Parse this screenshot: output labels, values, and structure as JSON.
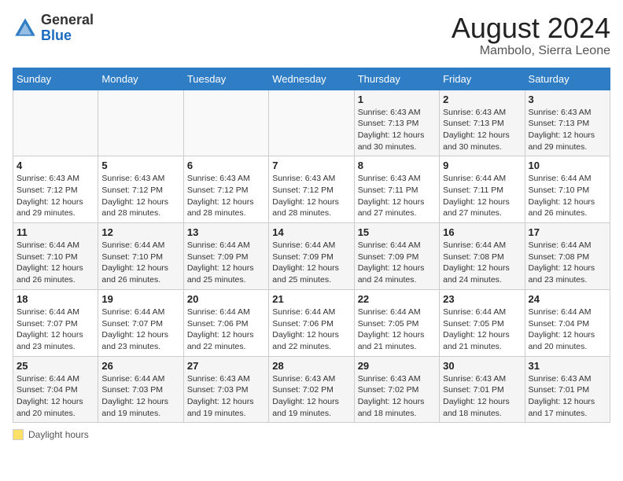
{
  "header": {
    "logo_general": "General",
    "logo_blue": "Blue",
    "month_year": "August 2024",
    "location": "Mambolo, Sierra Leone"
  },
  "days_of_week": [
    "Sunday",
    "Monday",
    "Tuesday",
    "Wednesday",
    "Thursday",
    "Friday",
    "Saturday"
  ],
  "weeks": [
    [
      {
        "day": "",
        "info": ""
      },
      {
        "day": "",
        "info": ""
      },
      {
        "day": "",
        "info": ""
      },
      {
        "day": "",
        "info": ""
      },
      {
        "day": "1",
        "info": "Sunrise: 6:43 AM\nSunset: 7:13 PM\nDaylight: 12 hours\nand 30 minutes."
      },
      {
        "day": "2",
        "info": "Sunrise: 6:43 AM\nSunset: 7:13 PM\nDaylight: 12 hours\nand 30 minutes."
      },
      {
        "day": "3",
        "info": "Sunrise: 6:43 AM\nSunset: 7:13 PM\nDaylight: 12 hours\nand 29 minutes."
      }
    ],
    [
      {
        "day": "4",
        "info": "Sunrise: 6:43 AM\nSunset: 7:12 PM\nDaylight: 12 hours\nand 29 minutes."
      },
      {
        "day": "5",
        "info": "Sunrise: 6:43 AM\nSunset: 7:12 PM\nDaylight: 12 hours\nand 28 minutes."
      },
      {
        "day": "6",
        "info": "Sunrise: 6:43 AM\nSunset: 7:12 PM\nDaylight: 12 hours\nand 28 minutes."
      },
      {
        "day": "7",
        "info": "Sunrise: 6:43 AM\nSunset: 7:12 PM\nDaylight: 12 hours\nand 28 minutes."
      },
      {
        "day": "8",
        "info": "Sunrise: 6:43 AM\nSunset: 7:11 PM\nDaylight: 12 hours\nand 27 minutes."
      },
      {
        "day": "9",
        "info": "Sunrise: 6:44 AM\nSunset: 7:11 PM\nDaylight: 12 hours\nand 27 minutes."
      },
      {
        "day": "10",
        "info": "Sunrise: 6:44 AM\nSunset: 7:10 PM\nDaylight: 12 hours\nand 26 minutes."
      }
    ],
    [
      {
        "day": "11",
        "info": "Sunrise: 6:44 AM\nSunset: 7:10 PM\nDaylight: 12 hours\nand 26 minutes."
      },
      {
        "day": "12",
        "info": "Sunrise: 6:44 AM\nSunset: 7:10 PM\nDaylight: 12 hours\nand 26 minutes."
      },
      {
        "day": "13",
        "info": "Sunrise: 6:44 AM\nSunset: 7:09 PM\nDaylight: 12 hours\nand 25 minutes."
      },
      {
        "day": "14",
        "info": "Sunrise: 6:44 AM\nSunset: 7:09 PM\nDaylight: 12 hours\nand 25 minutes."
      },
      {
        "day": "15",
        "info": "Sunrise: 6:44 AM\nSunset: 7:09 PM\nDaylight: 12 hours\nand 24 minutes."
      },
      {
        "day": "16",
        "info": "Sunrise: 6:44 AM\nSunset: 7:08 PM\nDaylight: 12 hours\nand 24 minutes."
      },
      {
        "day": "17",
        "info": "Sunrise: 6:44 AM\nSunset: 7:08 PM\nDaylight: 12 hours\nand 23 minutes."
      }
    ],
    [
      {
        "day": "18",
        "info": "Sunrise: 6:44 AM\nSunset: 7:07 PM\nDaylight: 12 hours\nand 23 minutes."
      },
      {
        "day": "19",
        "info": "Sunrise: 6:44 AM\nSunset: 7:07 PM\nDaylight: 12 hours\nand 23 minutes."
      },
      {
        "day": "20",
        "info": "Sunrise: 6:44 AM\nSunset: 7:06 PM\nDaylight: 12 hours\nand 22 minutes."
      },
      {
        "day": "21",
        "info": "Sunrise: 6:44 AM\nSunset: 7:06 PM\nDaylight: 12 hours\nand 22 minutes."
      },
      {
        "day": "22",
        "info": "Sunrise: 6:44 AM\nSunset: 7:05 PM\nDaylight: 12 hours\nand 21 minutes."
      },
      {
        "day": "23",
        "info": "Sunrise: 6:44 AM\nSunset: 7:05 PM\nDaylight: 12 hours\nand 21 minutes."
      },
      {
        "day": "24",
        "info": "Sunrise: 6:44 AM\nSunset: 7:04 PM\nDaylight: 12 hours\nand 20 minutes."
      }
    ],
    [
      {
        "day": "25",
        "info": "Sunrise: 6:44 AM\nSunset: 7:04 PM\nDaylight: 12 hours\nand 20 minutes."
      },
      {
        "day": "26",
        "info": "Sunrise: 6:44 AM\nSunset: 7:03 PM\nDaylight: 12 hours\nand 19 minutes."
      },
      {
        "day": "27",
        "info": "Sunrise: 6:43 AM\nSunset: 7:03 PM\nDaylight: 12 hours\nand 19 minutes."
      },
      {
        "day": "28",
        "info": "Sunrise: 6:43 AM\nSunset: 7:02 PM\nDaylight: 12 hours\nand 19 minutes."
      },
      {
        "day": "29",
        "info": "Sunrise: 6:43 AM\nSunset: 7:02 PM\nDaylight: 12 hours\nand 18 minutes."
      },
      {
        "day": "30",
        "info": "Sunrise: 6:43 AM\nSunset: 7:01 PM\nDaylight: 12 hours\nand 18 minutes."
      },
      {
        "day": "31",
        "info": "Sunrise: 6:43 AM\nSunset: 7:01 PM\nDaylight: 12 hours\nand 17 minutes."
      }
    ]
  ],
  "footer": {
    "daylight_label": "Daylight hours"
  }
}
